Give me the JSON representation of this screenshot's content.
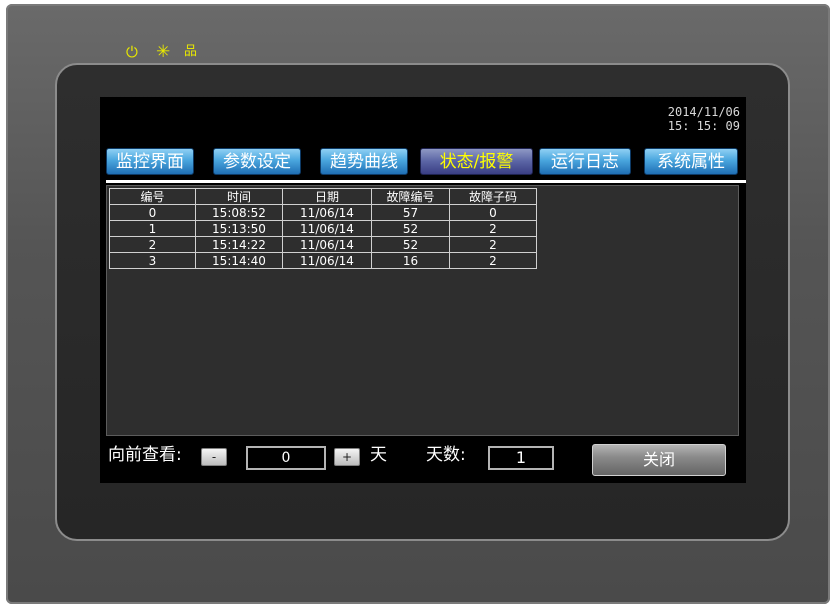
{
  "status_leds": [
    {
      "icon": "power-icon",
      "glyph": "⏻"
    },
    {
      "icon": "run-indicator-icon",
      "glyph": "✳"
    },
    {
      "icon": "network-icon",
      "glyph": "品"
    }
  ],
  "datetime": {
    "date": "2014/11/06",
    "time": "15: 15: 09"
  },
  "tabs": [
    {
      "label": "监控界面",
      "active": false
    },
    {
      "label": "参数设定",
      "active": false
    },
    {
      "label": "趋势曲线",
      "active": false
    },
    {
      "label": "状态/报警",
      "active": true
    },
    {
      "label": "运行日志",
      "active": false
    },
    {
      "label": "系统属性",
      "active": false
    }
  ],
  "table": {
    "headers": [
      "编号",
      "时间",
      "日期",
      "故障编号",
      "故障子码"
    ],
    "rows": [
      [
        "0",
        "15:08:52",
        "11/06/14",
        "57",
        "0"
      ],
      [
        "1",
        "15:13:50",
        "11/06/14",
        "52",
        "2"
      ],
      [
        "2",
        "15:14:22",
        "11/06/14",
        "52",
        "2"
      ],
      [
        "3",
        "15:14:40",
        "11/06/14",
        "16",
        "2"
      ]
    ]
  },
  "footer": {
    "lookback_label": "向前查看:",
    "minus_label": "-",
    "lookback_value": "0",
    "plus_label": "+",
    "day_unit": "天",
    "days_label": "天数:",
    "days_value": "1",
    "close_label": "关闭"
  },
  "colors": {
    "tab_blue": "#4aa6de",
    "tab_active": "#5a64a4",
    "active_text": "#ffff00",
    "led_yellow": "#e8e800"
  }
}
